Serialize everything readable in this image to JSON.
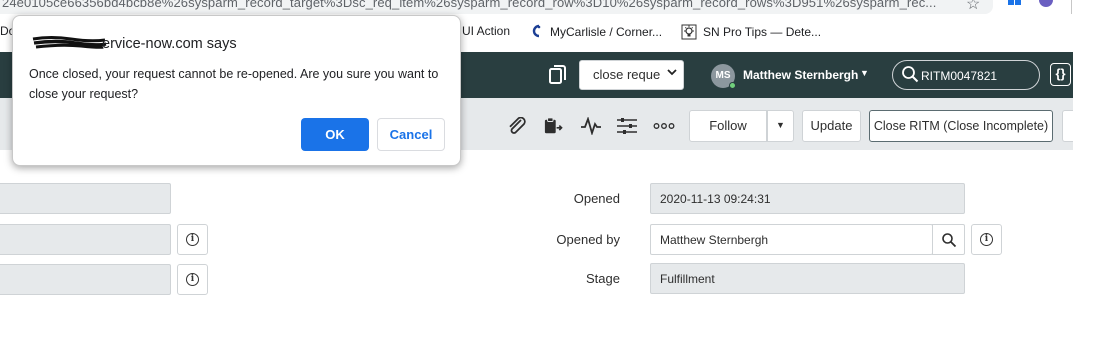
{
  "browser": {
    "url": "24e0105ce66356bd4bcb8e%26sysparm_record_target%3Dsc_req_item%26sysparm_record_row%3D10%26sysparm_record_rows%3D951%26sysparm_rec...",
    "star_icon": "star-icon",
    "bookmarks": [
      {
        "label": "Do",
        "icon": "page-icon"
      },
      {
        "label": "UI Action",
        "icon": ""
      },
      {
        "label": "MyCarlisle / Corner...",
        "icon": "carlisle-icon"
      },
      {
        "label": "SN Pro Tips — Dete...",
        "icon": "lightbulb-icon"
      }
    ]
  },
  "header": {
    "select_value": "close reque",
    "user_initials": "MS",
    "user_name": "Matthew Sternbergh",
    "search_value": "RITM0047821",
    "script_icon": "{}"
  },
  "toolbar": {
    "follow_label": "Follow",
    "update_label": "Update",
    "close_label": "Close RITM (Close Incomplete)"
  },
  "form": {
    "opened_label": "Opened",
    "opened_value": "2020-11-13 09:24:31",
    "opened_by_label": "Opened by",
    "opened_by_value": "Matthew Sternbergh",
    "stage_label": "Stage",
    "stage_value": "Fulfillment"
  },
  "dialog": {
    "title": "ervice-now.com says",
    "message": "Once closed, your request cannot be re-opened. Are you sure you want to close your request?",
    "ok_label": "OK",
    "cancel_label": "Cancel"
  },
  "colors": {
    "header_bg": "#293e40",
    "toolbar_bg": "#e6e9eb",
    "ok_button": "#1a73e8"
  }
}
